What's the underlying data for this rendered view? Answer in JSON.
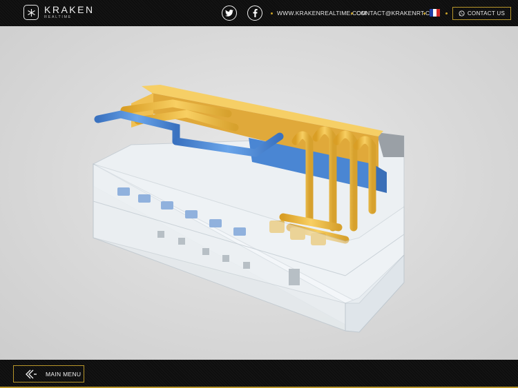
{
  "header": {
    "brand_name": "KRAKEN",
    "brand_sub": "REALTIME",
    "website": "WWW.KRAKENREALTIME.COM",
    "email": "CONTACT@KRAKENRT.COM",
    "contact_label": "CONTACT US",
    "social": [
      "twitter-icon",
      "facebook-icon"
    ],
    "language_flag": "fr-flag",
    "accent_color": "#c9a227"
  },
  "scene": {
    "model_colors": {
      "supply_pipes": "#f3c24a",
      "return_pipes": "#4f8fd8",
      "enclosure": "#eef3f6"
    }
  },
  "footer": {
    "main_menu_label": "MAIN MENU",
    "back_icon": "double-chevron-left-icon"
  }
}
